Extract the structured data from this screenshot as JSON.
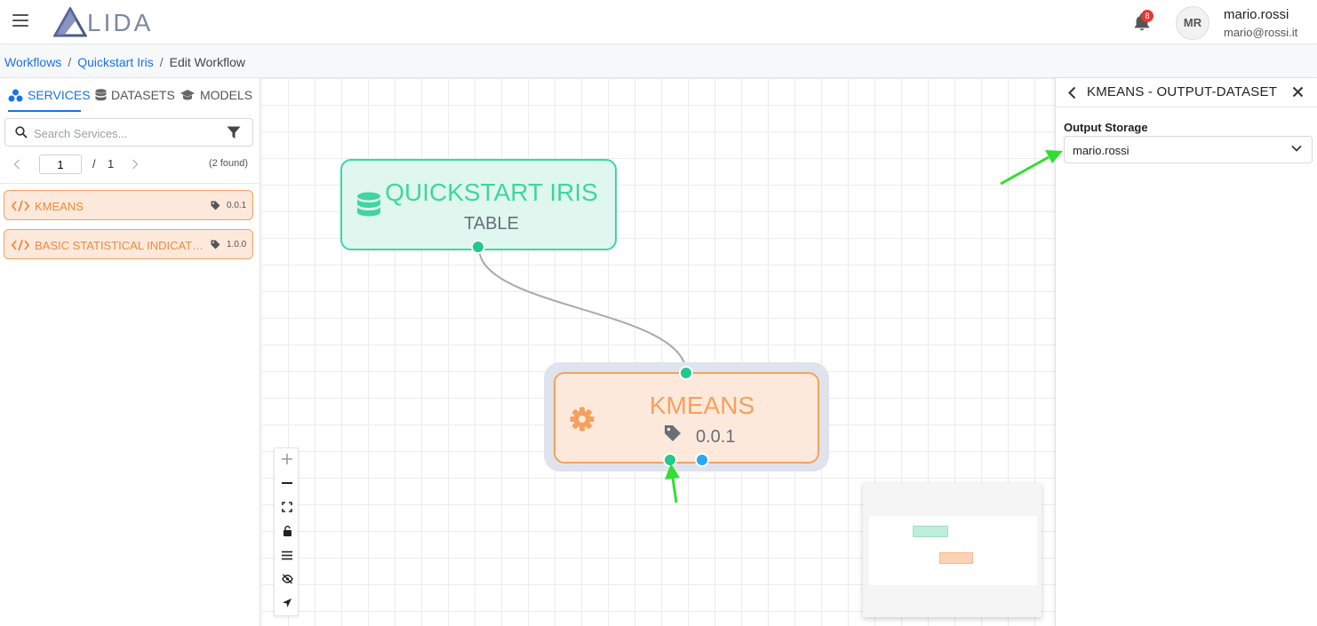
{
  "header": {
    "logo_text": "LIDA",
    "notification_count": "8",
    "avatar_initials": "MR",
    "user_name": "mario.rossi",
    "user_email": "mario@rossi.it"
  },
  "breadcrumb": {
    "items": [
      "Workflows",
      "Quickstart Iris"
    ],
    "current": "Edit Workflow",
    "separator": "/"
  },
  "sidebar": {
    "tabs": [
      {
        "label": "SERVICES",
        "icon": "services-icon",
        "active": true
      },
      {
        "label": "DATASETS",
        "icon": "database-icon",
        "active": false
      },
      {
        "label": "MODELS",
        "icon": "graduation-cap-icon",
        "active": false
      }
    ],
    "search_placeholder": "Search Services...",
    "pager": {
      "page": "1",
      "slash": "/",
      "total": "1",
      "found": "(2 found)"
    },
    "services": [
      {
        "label": "KMEANS",
        "version": "0.0.1"
      },
      {
        "label": "BASIC STATISTICAL INDICATORS",
        "version": "1.0.0"
      }
    ]
  },
  "canvas": {
    "nodes": [
      {
        "title": "QUICKSTART IRIS",
        "subtitle": "TABLE",
        "kind": "dataset",
        "color": "#3fd6a0"
      },
      {
        "title": "KMEANS",
        "version": "0.0.1",
        "kind": "service",
        "color": "#f5a15e"
      }
    ],
    "controls": [
      "zoom-in",
      "zoom-out",
      "fit-view",
      "lock",
      "menu",
      "hide",
      "navigate"
    ]
  },
  "panel": {
    "title": "KMEANS - OUTPUT-DATASET",
    "field_label": "Output Storage",
    "selected_value": "mario.rossi"
  },
  "colors": {
    "accent": "#1a73e8",
    "dataset_node": "#3fd6a0",
    "service_node": "#f5a15e",
    "port_blue": "#2ba8f0",
    "annotation_arrow": "#33dd33"
  }
}
